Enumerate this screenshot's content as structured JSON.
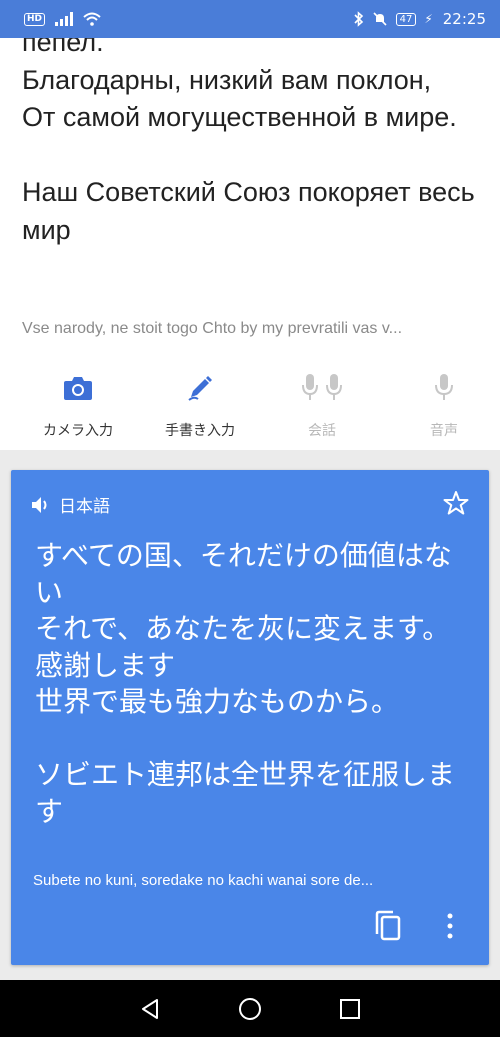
{
  "status": {
    "hd": "HD",
    "battery": "47",
    "time": "22:25"
  },
  "source": {
    "text": "пепел.\nБлагодарны, низкий вам поклон,\nОт самой могущественной в мире.\n\nНаш Советский Союз покоряет весь мир",
    "transliteration": "Vse narody, ne stoit togo Chto by my prevratili vas v..."
  },
  "tools": [
    {
      "label": "カメラ入力",
      "icon": "camera-icon"
    },
    {
      "label": "手書き入力",
      "icon": "pen-icon"
    },
    {
      "label": "会話",
      "icon": "microphones-icon"
    },
    {
      "label": "音声",
      "icon": "microphone-icon"
    }
  ],
  "translation": {
    "language": "日本語",
    "text": "すべての国、それだけの価値はない\n それで、あなたを灰に変えます。\n 感謝します\n 世界で最も強力なものから。\n\n ソビエト連邦は全世界を征服します",
    "transliteration": "Subete no kuni, soredake no kachi wanai sore de..."
  },
  "colors": {
    "accent": "#4a86e8",
    "statusbar": "#4a7dd8",
    "icon_active": "#3d6fd6",
    "icon_disabled": "#c7c7c7"
  }
}
